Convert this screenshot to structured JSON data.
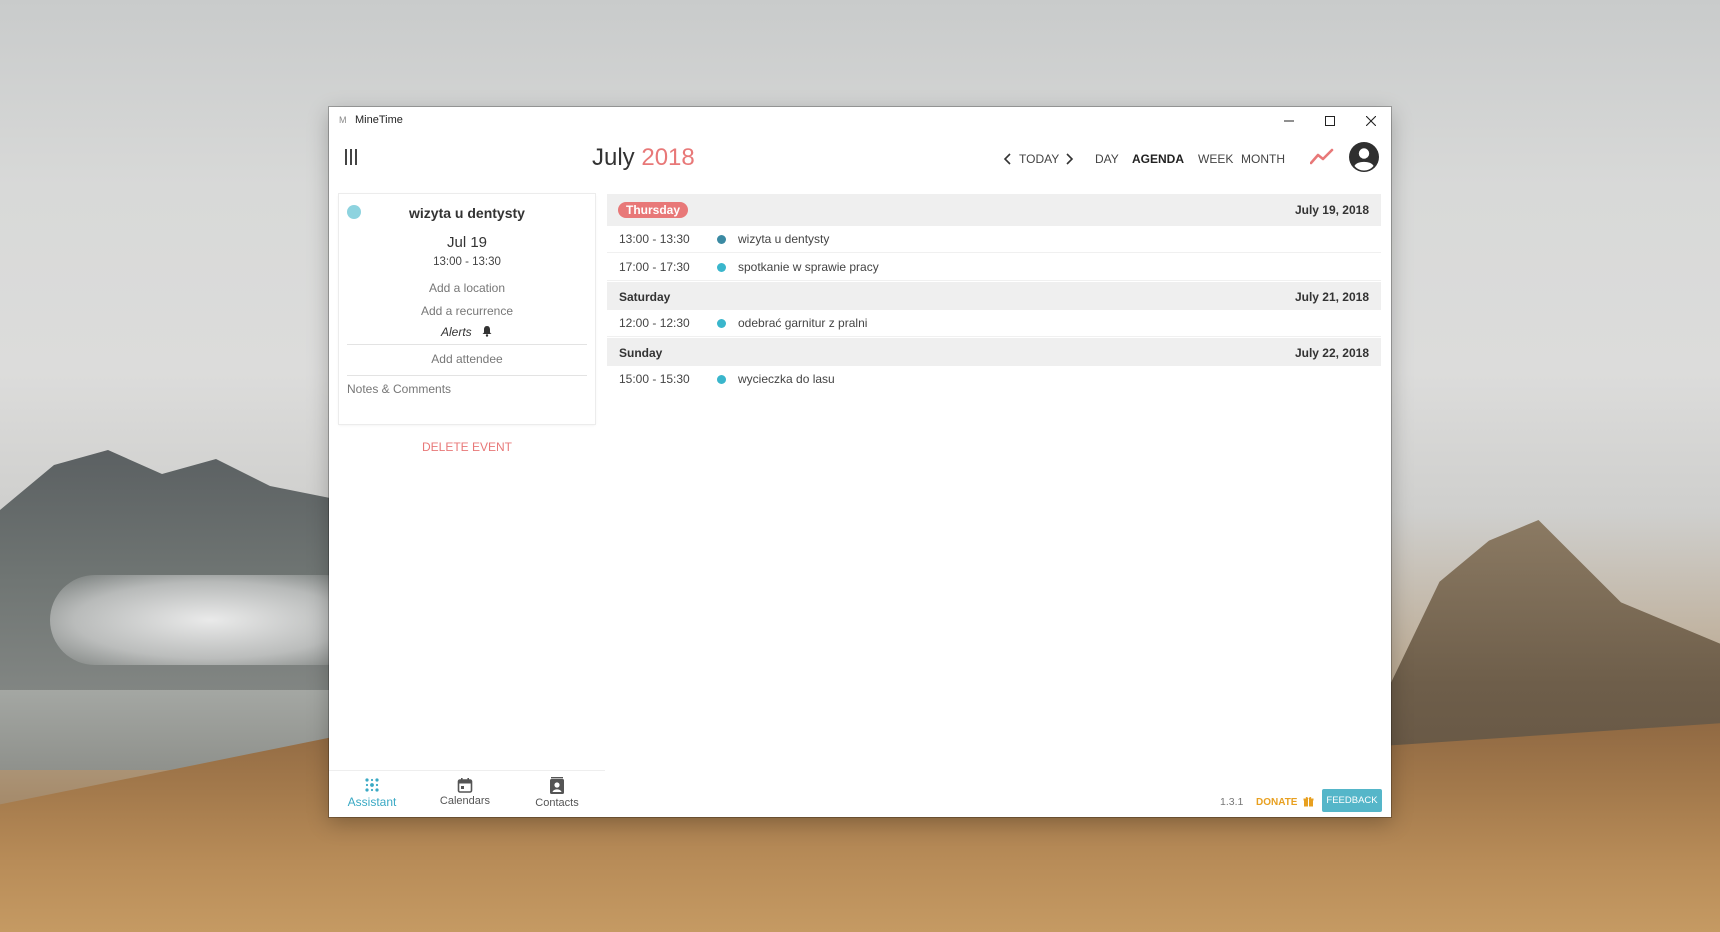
{
  "window": {
    "title": "MineTime",
    "app_icon_glyph": "M"
  },
  "header": {
    "month": "July",
    "year": "2018",
    "today_label": "TODAY",
    "views": {
      "day": "DAY",
      "agenda": "AGENDA",
      "week": "WEEK",
      "month": "MONTH"
    },
    "active_view": "AGENDA"
  },
  "event_detail": {
    "title": "wizyta u dentysty",
    "date": "Jul 19",
    "time": "13:00 - 13:30",
    "add_location": "Add a location",
    "add_recurrence": "Add a recurrence",
    "alerts": "Alerts",
    "add_attendee": "Add attendee",
    "notes": "Notes & Comments",
    "color": "#8dd3df",
    "delete_label": "DELETE EVENT"
  },
  "agenda": {
    "days": [
      {
        "name": "Thursday",
        "date": "July 19, 2018",
        "is_today": true,
        "events": [
          {
            "time": "13:00 - 13:30",
            "title": "wizyta u dentysty",
            "color": "#3b8aa3"
          },
          {
            "time": "17:00 - 17:30",
            "title": "spotkanie w sprawie pracy",
            "color": "#3ab6cc"
          }
        ]
      },
      {
        "name": "Saturday",
        "date": "July 21, 2018",
        "is_today": false,
        "events": [
          {
            "time": "12:00 - 12:30",
            "title": "odebrać garnitur z pralni",
            "color": "#3ab6cc"
          }
        ]
      },
      {
        "name": "Sunday",
        "date": "July 22, 2018",
        "is_today": false,
        "events": [
          {
            "time": "15:00 - 15:30",
            "title": "wycieczka do lasu",
            "color": "#3ab6cc"
          }
        ]
      }
    ]
  },
  "bottom_tabs": {
    "assistant": "Assistant",
    "calendars": "Calendars",
    "contacts": "Contacts",
    "active": "Assistant"
  },
  "footer": {
    "version": "1.3.1",
    "donate": "DONATE",
    "feedback": "FEEDBACK"
  },
  "colors": {
    "accent_red": "#e87878",
    "accent_teal": "#55b6c9",
    "donate_orange": "#e8a020"
  }
}
